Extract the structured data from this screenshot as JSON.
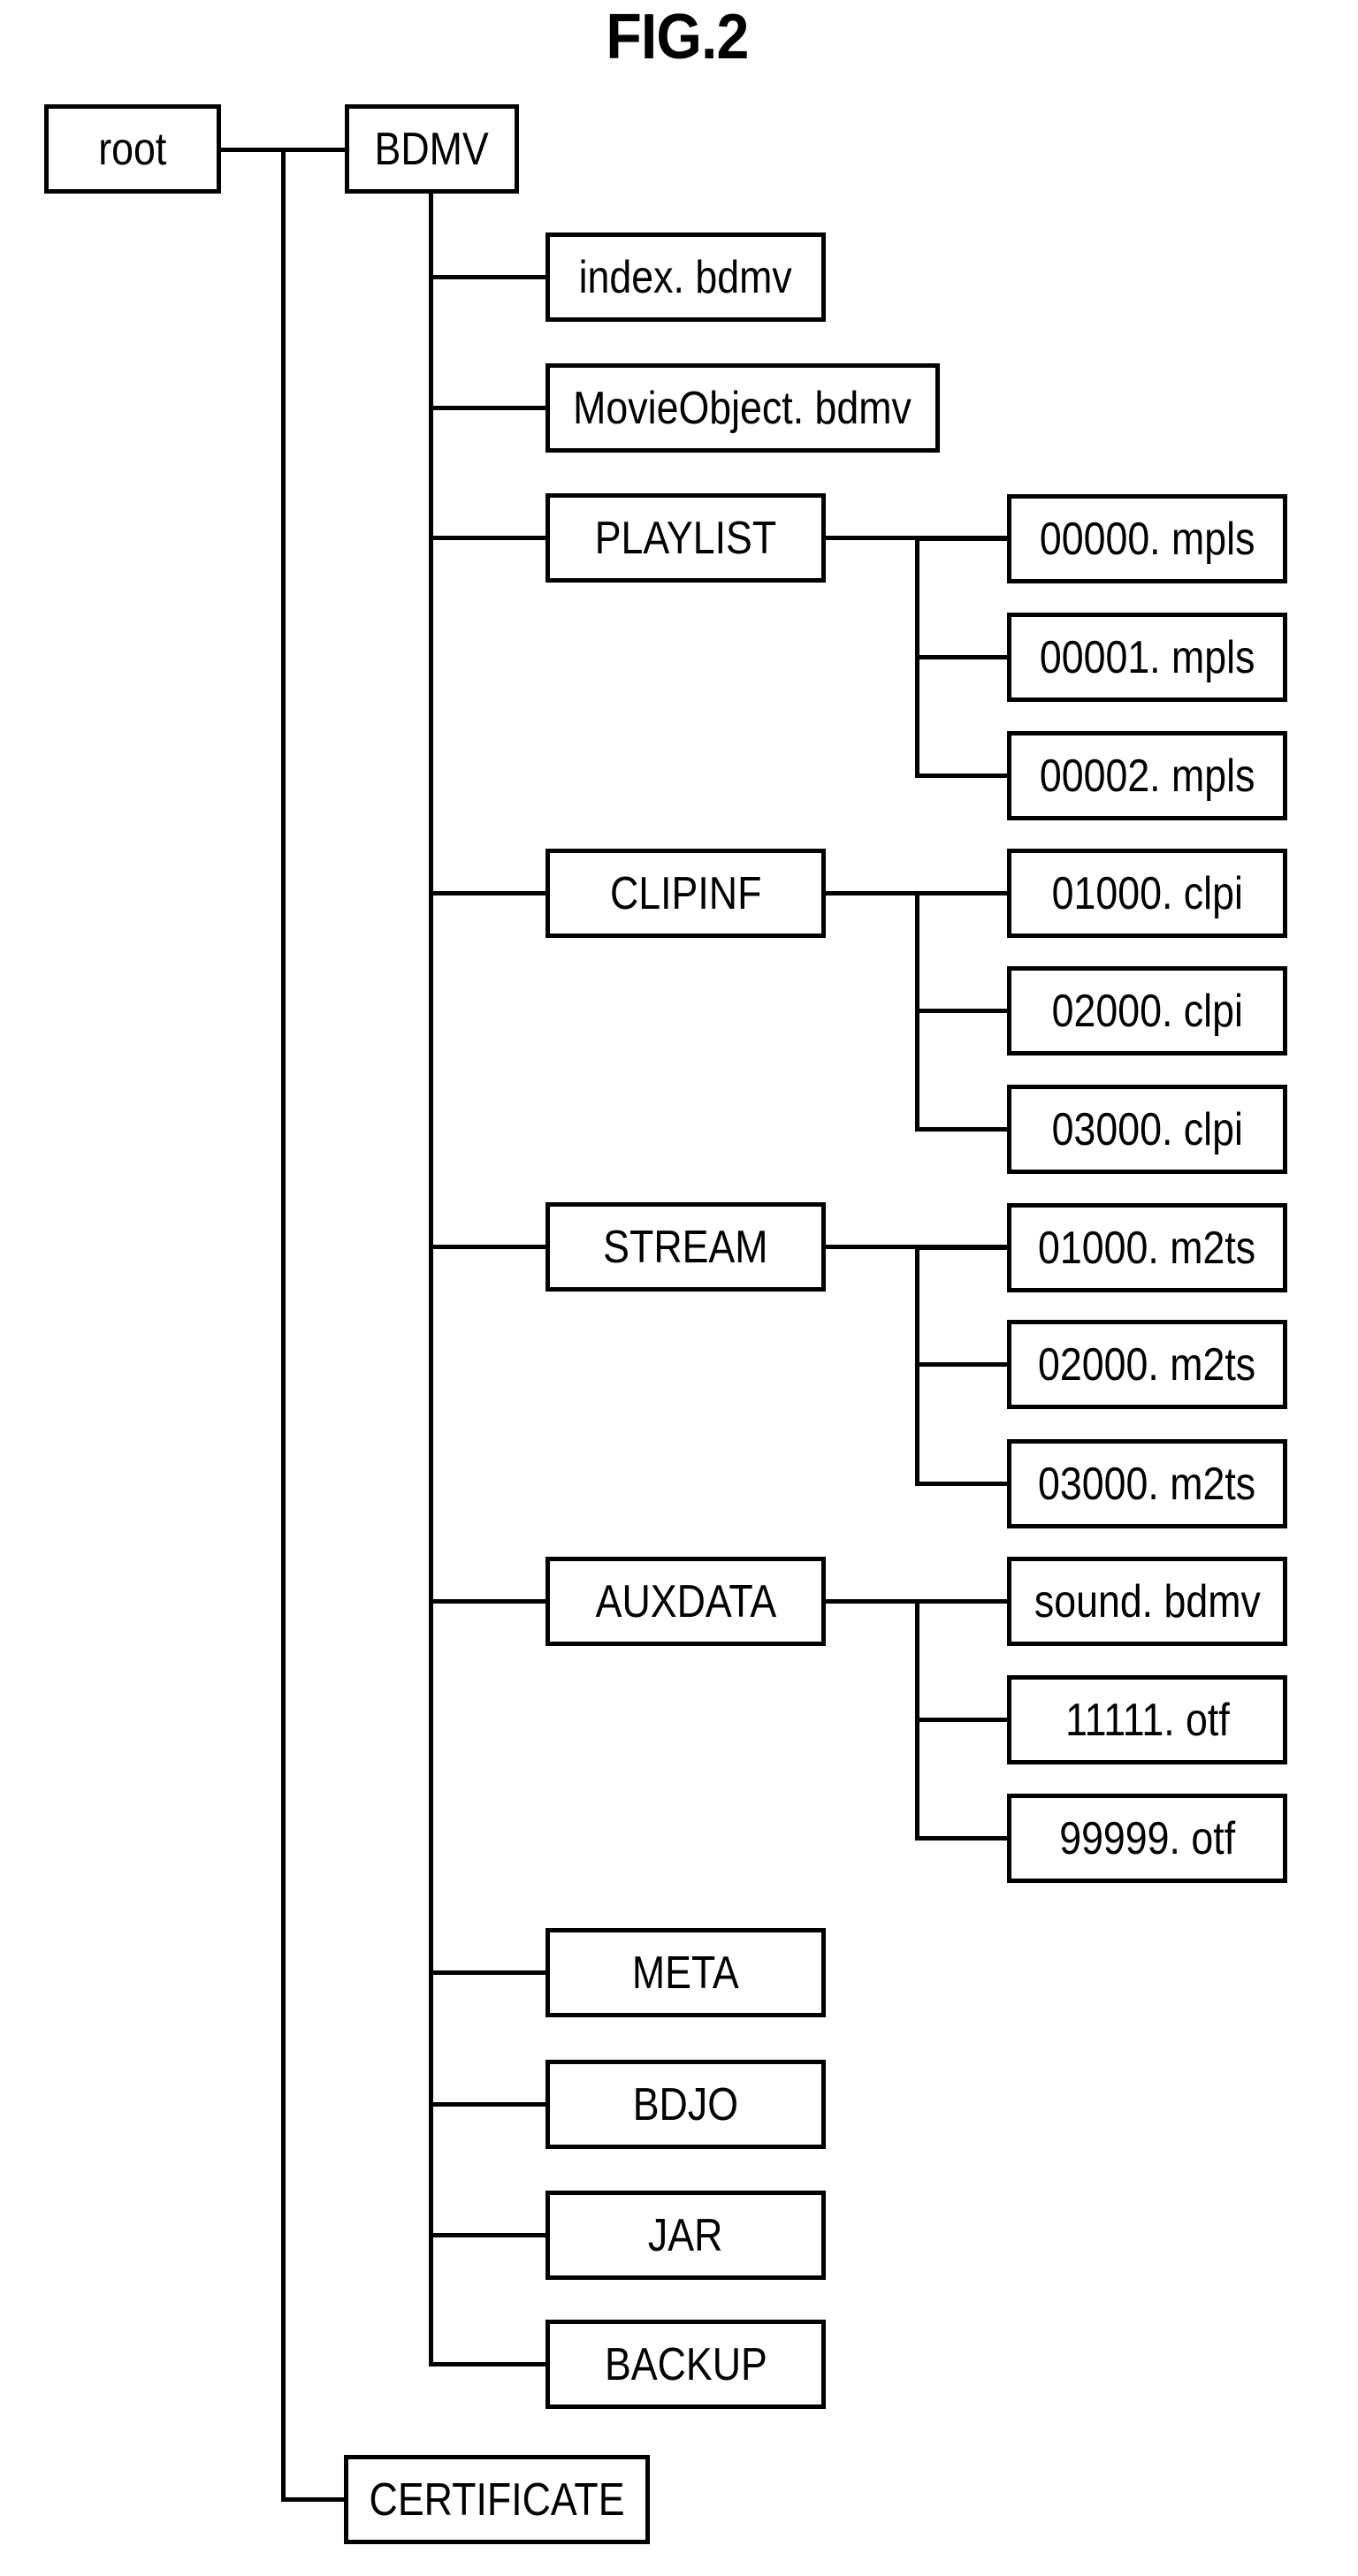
{
  "figure": {
    "title": "FIG.2"
  },
  "tree": {
    "root": {
      "label": "root"
    },
    "top_level": [
      {
        "label": "BDMV",
        "children": [
          {
            "label": "index. bdmv",
            "type": "file"
          },
          {
            "label": "MovieObject. bdmv",
            "type": "file"
          },
          {
            "label": "PLAYLIST",
            "type": "directory",
            "children": [
              "00000. mpls",
              "00001. mpls",
              "00002. mpls"
            ]
          },
          {
            "label": "CLIPINF",
            "type": "directory",
            "children": [
              "01000. clpi",
              "02000. clpi",
              "03000. clpi"
            ]
          },
          {
            "label": "STREAM",
            "type": "directory",
            "children": [
              "01000. m2ts",
              "02000. m2ts",
              "03000. m2ts"
            ]
          },
          {
            "label": "AUXDATA",
            "type": "directory",
            "children": [
              "sound. bdmv",
              "11111. otf",
              "99999. otf"
            ]
          },
          {
            "label": "META",
            "type": "directory"
          },
          {
            "label": "BDJO",
            "type": "directory"
          },
          {
            "label": "JAR",
            "type": "directory"
          },
          {
            "label": "BACKUP",
            "type": "directory"
          }
        ]
      },
      {
        "label": "CERTIFICATE",
        "type": "directory"
      }
    ]
  }
}
